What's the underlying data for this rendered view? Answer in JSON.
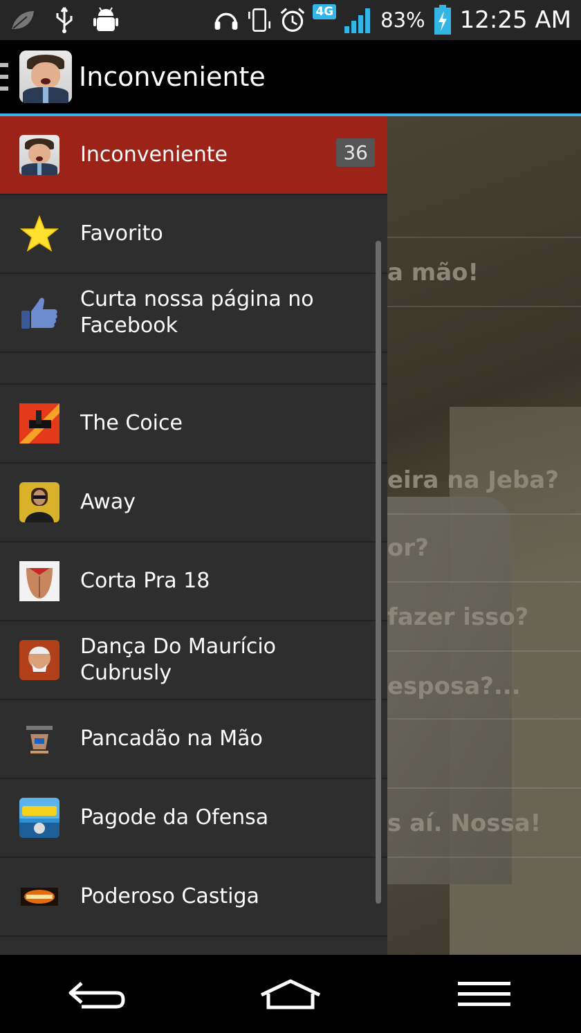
{
  "status_bar": {
    "network_type": "4G",
    "battery_percent": "83%",
    "time": "12:25 AM",
    "left_icons": [
      "leaf-icon",
      "usb-icon",
      "android-debug-icon"
    ],
    "right_icons": [
      "headset-icon",
      "vibrate-icon",
      "alarm-icon",
      "signal-icon",
      "battery-charging-icon"
    ]
  },
  "action_bar": {
    "title": "Inconveniente",
    "icon": "app-avatar-icon"
  },
  "drawer": {
    "items": [
      {
        "label": "Inconveniente",
        "badge": "36",
        "icon": "app-avatar-icon",
        "active": true
      },
      {
        "label": "Favorito",
        "icon": "star-icon"
      },
      {
        "label": "Curta nossa página no Facebook",
        "icon": "thumbs-up-icon"
      },
      {
        "label": "The Coice",
        "icon": "the-coice-thumbnail"
      },
      {
        "label": "Away",
        "icon": "away-thumbnail"
      },
      {
        "label": "Corta Pra 18",
        "icon": "corta-pra-18-thumbnail"
      },
      {
        "label": "Dança Do Maurício Cubrusly",
        "icon": "danca-thumbnail"
      },
      {
        "label": "Pancadão na Mão",
        "icon": "pancadao-thumbnail"
      },
      {
        "label": "Pagode da Ofensa",
        "icon": "pagode-thumbnail"
      },
      {
        "label": "Poderoso Castiga",
        "icon": "poderoso-thumbnail"
      }
    ]
  },
  "background_list": {
    "visible_fragments": [
      "a mão!",
      "eira na Jeba?",
      "or?",
      "fazer isso?",
      "esposa?...",
      "s aí. Nossa!"
    ]
  },
  "nav_bar": {
    "buttons": [
      "back-icon",
      "home-icon",
      "menu-icon"
    ]
  }
}
